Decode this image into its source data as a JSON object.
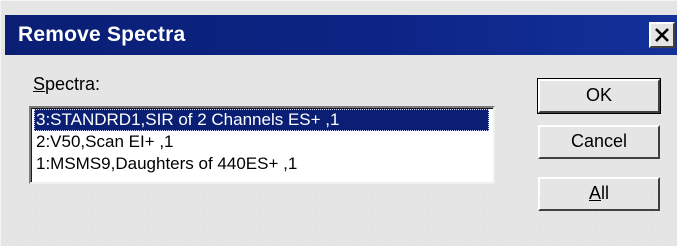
{
  "dialog": {
    "title": "Remove Spectra",
    "close_label": "×"
  },
  "spectra": {
    "label_mnemonic": "S",
    "label_rest": "pectra:",
    "items": [
      {
        "label": "3:STANDRD1,SIR of 2 Channels ES+ ,1",
        "selected": true
      },
      {
        "label": "2:V50,Scan EI+ ,1",
        "selected": false
      },
      {
        "label": "1:MSMS9,Daughters of 440ES+ ,1",
        "selected": false
      }
    ]
  },
  "buttons": {
    "ok": "OK",
    "cancel": "Cancel",
    "all_mnemonic": "A",
    "all_rest": "ll"
  },
  "colors": {
    "titlebar": "#0a1f74",
    "selection": "#0a1f74",
    "face": "#e5e5e5"
  }
}
